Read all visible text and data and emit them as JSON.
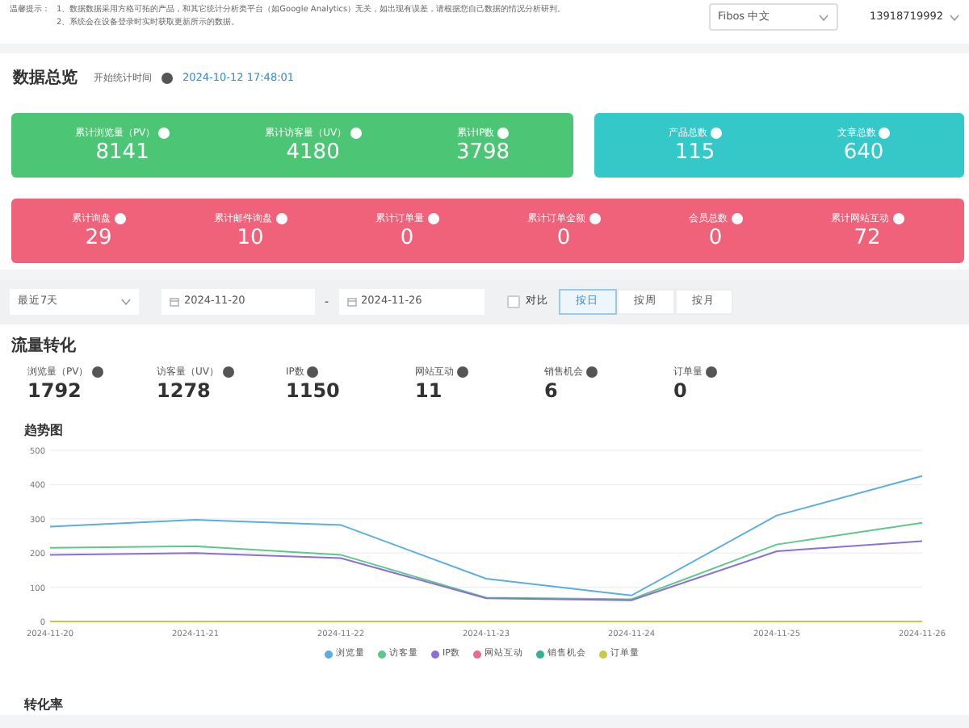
{
  "notice": {
    "label": "温馨提示：",
    "lines": [
      "1、数据数据采用方格可拓的产品，和其它统计分析类平台（如Google Analytics）无关，如出现有误差，请根据您自己数据的情况分析研判。",
      "2、系统会在设备登录时实时获取更新所示的数据。"
    ]
  },
  "language_select": {
    "value": "Fibos 中文"
  },
  "account": {
    "label": "13918719992"
  },
  "overview": {
    "title": "数据总览",
    "start_label": "开始统计时间",
    "start_time": "2024-10-12 17:48:01"
  },
  "stat_groups": [
    {
      "color": "#4cc674",
      "stats": [
        {
          "label": "累计浏览量（PV）",
          "value": "8141"
        },
        {
          "label": "累计访客量（UV）",
          "value": "4180"
        },
        {
          "label": "累计IP数",
          "value": "3798"
        }
      ]
    },
    {
      "color": "#35c8c8",
      "stats": [
        {
          "label": "产品总数",
          "value": "115"
        },
        {
          "label": "文章总数",
          "value": "640"
        }
      ]
    },
    {
      "color": "#f0627a",
      "stats": [
        {
          "label": "累计询盘",
          "value": "29"
        },
        {
          "label": "累计邮件询盘",
          "value": "10"
        },
        {
          "label": "累计订单量",
          "value": "0"
        },
        {
          "label": "累计订单金额",
          "value": "0"
        },
        {
          "label": "会员总数",
          "value": "0"
        },
        {
          "label": "累计网站互动",
          "value": "72"
        }
      ]
    }
  ],
  "filter": {
    "range": "最近7天",
    "start_date": "2024-11-20",
    "separator": "-",
    "end_date": "2024-11-26",
    "compare": {
      "label": "对比",
      "checked": false
    },
    "periods": [
      {
        "label": "按日",
        "selected": true
      },
      {
        "label": "按周",
        "selected": false
      },
      {
        "label": "按月",
        "selected": false
      }
    ]
  },
  "traffic": {
    "title": "流量转化",
    "metrics": [
      {
        "label": "浏览量（PV）",
        "value": "1792"
      },
      {
        "label": "访客量（UV）",
        "value": "1278"
      },
      {
        "label": "IP数",
        "value": "1150"
      },
      {
        "label": "网站互动",
        "value": "11"
      },
      {
        "label": "销售机会",
        "value": "6"
      },
      {
        "label": "订单量",
        "value": "0"
      }
    ]
  },
  "trend": {
    "title": "趋势图",
    "chart_data": {
      "type": "line",
      "categories": [
        "2024-11-20",
        "2024-11-21",
        "2024-11-22",
        "2024-11-23",
        "2024-11-24",
        "2024-11-25",
        "2024-11-26"
      ],
      "ylim": [
        0,
        500
      ],
      "grid": true,
      "yticks": [
        0,
        100,
        200,
        300,
        400,
        500
      ],
      "series": [
        {
          "name": "浏览量",
          "color": "#5aaee0",
          "values": [
            277,
            297,
            282,
            125,
            76,
            310,
            425
          ]
        },
        {
          "name": "访客量",
          "color": "#5cc98a",
          "values": [
            215,
            220,
            195,
            70,
            65,
            225,
            288
          ]
        },
        {
          "name": "IP数",
          "color": "#8a6fd8",
          "values": [
            195,
            200,
            185,
            68,
            62,
            205,
            235
          ]
        },
        {
          "name": "网站互动",
          "color": "#e86c8a",
          "values": [
            null,
            null,
            null,
            null,
            null,
            null,
            null
          ]
        },
        {
          "name": "销售机会",
          "color": "#36b08f",
          "values": [
            null,
            null,
            null,
            null,
            null,
            null,
            null
          ]
        },
        {
          "name": "订单量",
          "color": "#c8c84a",
          "values": [
            0,
            0,
            0,
            0,
            0,
            0,
            0
          ]
        }
      ]
    }
  },
  "conversion": {
    "title": "转化率"
  }
}
